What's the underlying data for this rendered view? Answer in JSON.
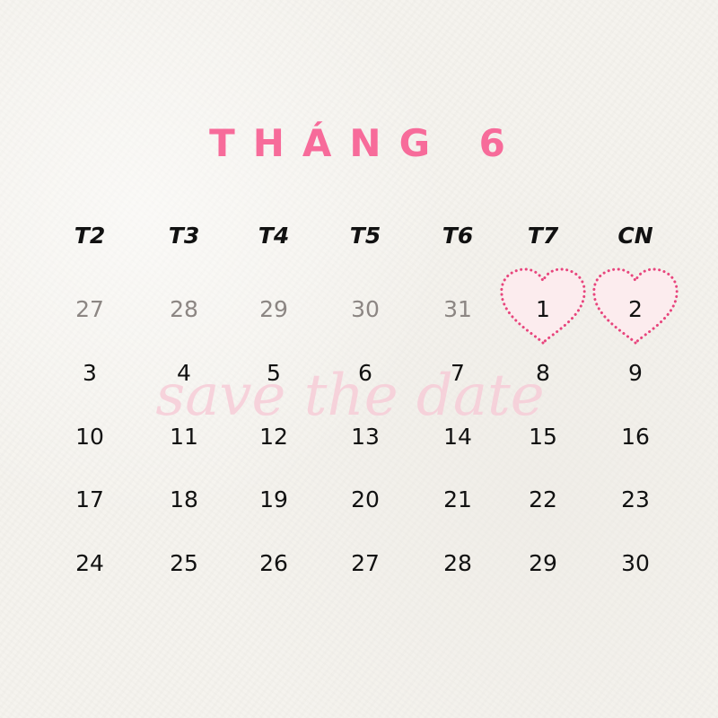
{
  "calendar": {
    "title": "THÁNG 6",
    "watermark": "save the date",
    "weekdays": [
      "T2",
      "T3",
      "T4",
      "T5",
      "T6",
      "T7",
      "CN"
    ],
    "weeks": [
      [
        "27",
        "28",
        "29",
        "30",
        "31",
        "1",
        "2"
      ],
      [
        "3",
        "4",
        "5",
        "6",
        "7",
        "8",
        "9"
      ],
      [
        "10",
        "11",
        "12",
        "13",
        "14",
        "15",
        "16"
      ],
      [
        "17",
        "18",
        "19",
        "20",
        "21",
        "22",
        "23"
      ],
      [
        "24",
        "25",
        "26",
        "27",
        "28",
        "29",
        "30"
      ]
    ],
    "muted_days": [
      "27",
      "28",
      "29",
      "30",
      "31"
    ],
    "highlighted_days": [
      "1",
      "2"
    ],
    "highlight_icon": "heart-icon",
    "colors": {
      "accent": "#f76b9a",
      "heart_fill": "#fcecee",
      "heart_border": "#e8457d",
      "muted_text": "#8c8683",
      "text": "#111111",
      "watermark": "#f7cdd8"
    }
  }
}
